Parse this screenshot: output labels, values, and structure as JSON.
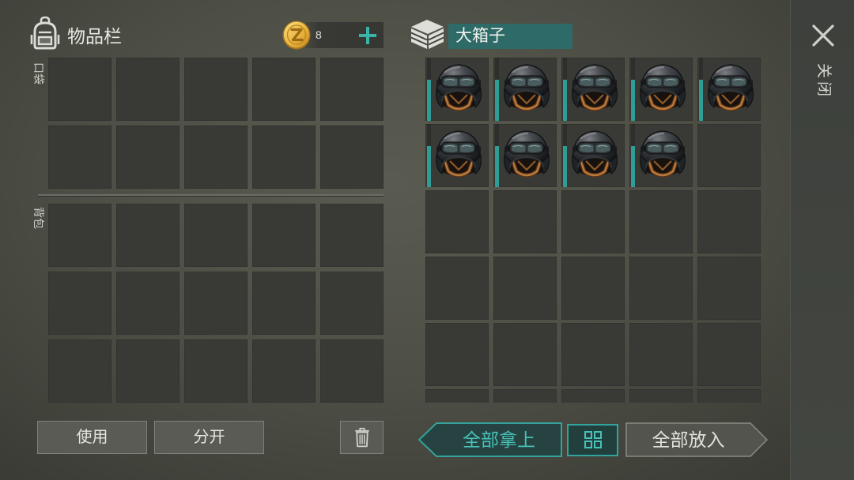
{
  "inventory": {
    "icon": "backpack-icon",
    "title": "物品栏",
    "currency": {
      "icon": "coin-icon",
      "amount": "8",
      "add_icon": "plus-icon"
    },
    "pocket": {
      "label": "口袋",
      "items": []
    },
    "backpack": {
      "label": "背包",
      "items": []
    },
    "actions": {
      "use_label": "使用",
      "split_label": "分开",
      "delete_icon": "trash-icon"
    }
  },
  "container": {
    "icon": "box-icon",
    "name": "大箱子",
    "items": [
      {
        "icon": "helmet-icon",
        "durability": 0.65
      },
      {
        "icon": "helmet-icon",
        "durability": 0.65
      },
      {
        "icon": "helmet-icon",
        "durability": 0.65
      },
      {
        "icon": "helmet-icon",
        "durability": 0.65
      },
      {
        "icon": "helmet-icon",
        "durability": 0.65
      },
      {
        "icon": "helmet-icon",
        "durability": 0.65
      },
      {
        "icon": "helmet-icon",
        "durability": 0.65
      },
      {
        "icon": "helmet-icon",
        "durability": 0.65
      },
      {
        "icon": "helmet-icon",
        "durability": 0.65
      }
    ],
    "actions": {
      "take_all_label": "全部拿上",
      "sort_icon": "grid-icon",
      "put_all_label": "全部放入"
    }
  },
  "close": {
    "icon": "close-icon",
    "label": "关闭"
  },
  "colors": {
    "accent": "#33a39b",
    "accent_text": "#48c2b9",
    "name_field": "#2e6b68",
    "durability": "#2f9d95",
    "coin_gold": "#e7b43c"
  }
}
